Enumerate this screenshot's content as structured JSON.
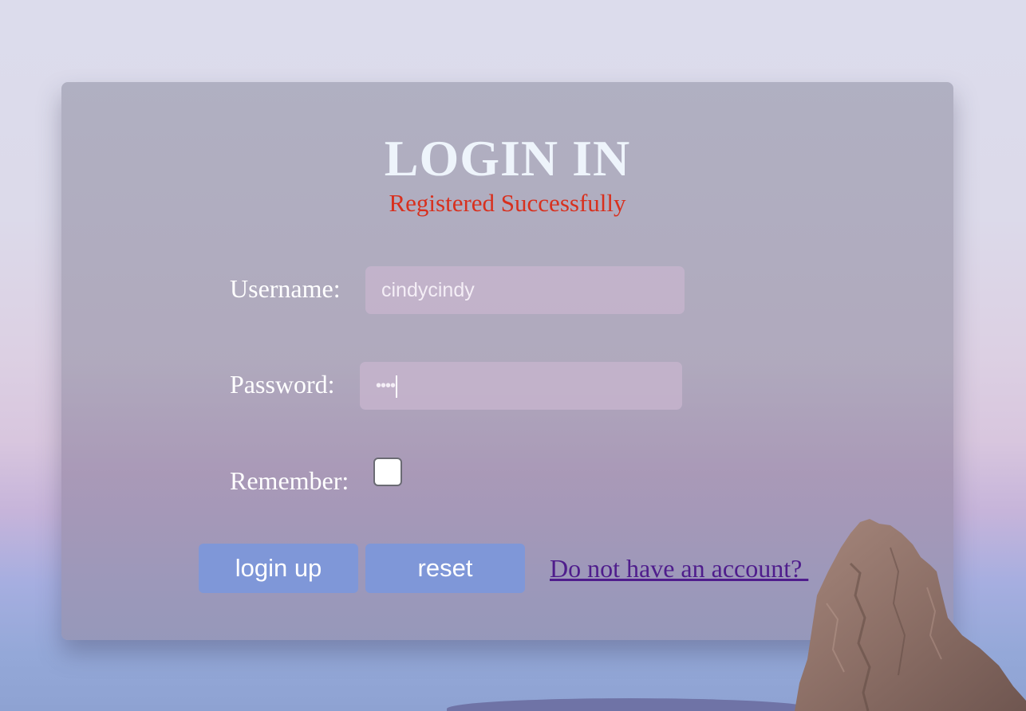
{
  "login": {
    "title": "LOGIN IN",
    "status_message": "Registered Successfully",
    "colors": {
      "status": "#d8301e",
      "button": "#7f97d8",
      "link": "#4f1d8c"
    },
    "username": {
      "label": "Username:",
      "value": "cindycindy"
    },
    "password": {
      "label": "Password:",
      "masked_value": "••••"
    },
    "remember": {
      "label": "Remember:",
      "checked": false
    },
    "buttons": {
      "login": "login up",
      "reset": "reset"
    },
    "signup_link": "Do not have an account? "
  }
}
